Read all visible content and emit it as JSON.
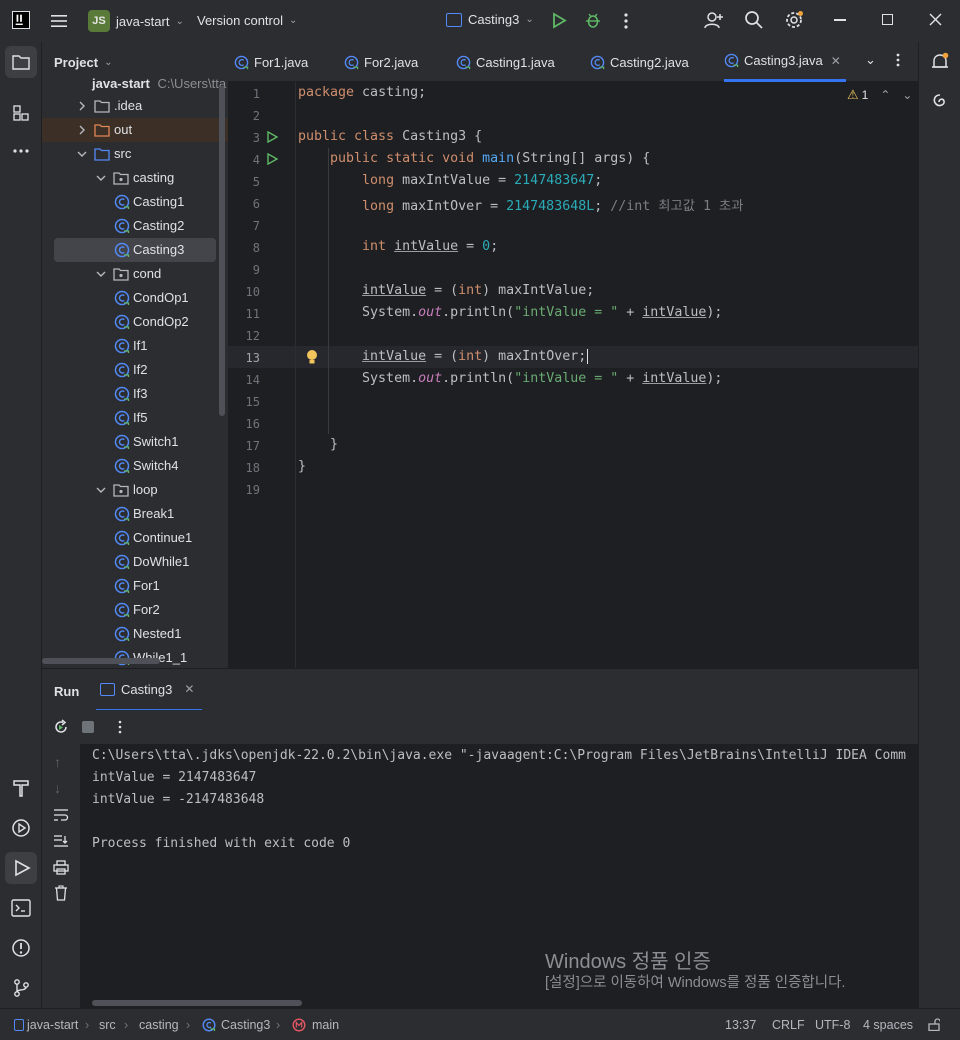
{
  "titlebar": {
    "project_badge": "JS",
    "project_name": "java-start",
    "vcs": "Version control",
    "run_config": "Casting3"
  },
  "project_panel": {
    "title": "Project",
    "root": "java-start",
    "root_path": "C:\\Users\\tta",
    "items": [
      {
        "label": ".idea",
        "kind": "folder"
      },
      {
        "label": "out",
        "kind": "folder-excluded"
      },
      {
        "label": "src",
        "kind": "source-folder"
      },
      {
        "label": "casting",
        "kind": "package"
      },
      {
        "label": "Casting1",
        "kind": "class"
      },
      {
        "label": "Casting2",
        "kind": "class"
      },
      {
        "label": "Casting3",
        "kind": "class",
        "selected": true
      },
      {
        "label": "cond",
        "kind": "package"
      },
      {
        "label": "CondOp1",
        "kind": "class"
      },
      {
        "label": "CondOp2",
        "kind": "class"
      },
      {
        "label": "If1",
        "kind": "class"
      },
      {
        "label": "If2",
        "kind": "class"
      },
      {
        "label": "If3",
        "kind": "class"
      },
      {
        "label": "If5",
        "kind": "class"
      },
      {
        "label": "Switch1",
        "kind": "class"
      },
      {
        "label": "Switch4",
        "kind": "class"
      },
      {
        "label": "loop",
        "kind": "package"
      },
      {
        "label": "Break1",
        "kind": "class"
      },
      {
        "label": "Continue1",
        "kind": "class"
      },
      {
        "label": "DoWhile1",
        "kind": "class"
      },
      {
        "label": "For1",
        "kind": "class"
      },
      {
        "label": "For2",
        "kind": "class"
      },
      {
        "label": "Nested1",
        "kind": "class"
      },
      {
        "label": "While1_1",
        "kind": "class"
      }
    ]
  },
  "tabs": [
    {
      "label": "For1.java"
    },
    {
      "label": "For2.java"
    },
    {
      "label": "Casting1.java"
    },
    {
      "label": "Casting2.java"
    },
    {
      "label": "Casting3.java",
      "active": true
    }
  ],
  "editor": {
    "warnings_count": "1",
    "line_numbers": [
      "1",
      "2",
      "3",
      "4",
      "5",
      "6",
      "7",
      "8",
      "9",
      "10",
      "11",
      "12",
      "13",
      "14",
      "15",
      "16",
      "17",
      "18",
      "19"
    ],
    "current_line": 13
  },
  "run_panel": {
    "title": "Run",
    "tab": "Casting3",
    "console": [
      "C:\\Users\\tta\\.jdks\\openjdk-22.0.2\\bin\\java.exe \"-javaagent:C:\\Program Files\\JetBrains\\IntelliJ IDEA Comm",
      "intValue = 2147483647",
      "intValue = -2147483648",
      "",
      "Process finished with exit code 0"
    ]
  },
  "watermark": {
    "title": "Windows 정품 인증",
    "subtitle": "[설정]으로 이동하여 Windows를 정품 인증합니다."
  },
  "statusbar": {
    "breadcrumbs": [
      "java-start",
      "src",
      "casting",
      "Casting3",
      "main"
    ],
    "position": "13:37",
    "line_sep": "CRLF",
    "encoding": "UTF-8",
    "indent": "4 spaces"
  },
  "colors": {
    "background": "#1e1f22",
    "panel": "#2b2d30",
    "accent": "#3574f0",
    "run_green": "#5fb865",
    "keyword": "#cf8e6d",
    "number": "#2aacb8",
    "string": "#6aab73",
    "method": "#56a8f5",
    "warning": "#f2c55c"
  },
  "icons": [
    "hamburger-icon",
    "play-icon",
    "debug-icon",
    "more-icon",
    "add-user-icon",
    "search-icon",
    "gear-icon",
    "minimize-icon",
    "maximize-icon",
    "close-icon",
    "folder-icon",
    "structure-icon",
    "notifications-icon",
    "ai-icon",
    "build-icon",
    "services-icon",
    "run-icon",
    "terminal-icon",
    "problems-icon",
    "git-icon",
    "rerun-icon",
    "stop-icon",
    "lightbulb-icon",
    "lock-icon"
  ]
}
